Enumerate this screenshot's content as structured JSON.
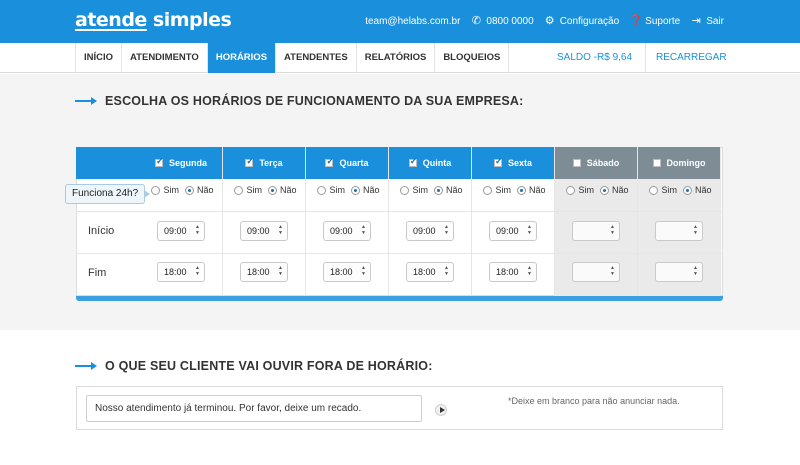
{
  "header": {
    "logo_a": "atende",
    "logo_b": " simples",
    "email": "team@helabs.com.br",
    "phone": "0800 0000",
    "config": "Configuração",
    "support": "Suporte",
    "logout": "Sair"
  },
  "nav": {
    "tabs": [
      "INÍCIO",
      "ATENDIMENTO",
      "HORÁRIOS",
      "ATENDENTES",
      "RELATÓRIOS",
      "BLOQUEIOS"
    ],
    "active_tab": "HORÁRIOS",
    "saldo": "SALDO -R$ 9,64",
    "recarregar": "RECARREGAR"
  },
  "hours_section": {
    "title": "ESCOLHA OS HORÁRIOS DE FUNCIONAMENTO DA SUA EMPRESA:",
    "tooltip": "Funciona 24h?",
    "yes_label": "Sim",
    "no_label": "Não",
    "row_start": "Início",
    "row_end": "Fim",
    "days": [
      {
        "name": "Segunda",
        "checked": true,
        "start": "09:00",
        "end": "18:00"
      },
      {
        "name": "Terça",
        "checked": true,
        "start": "09:00",
        "end": "18:00"
      },
      {
        "name": "Quarta",
        "checked": true,
        "start": "09:00",
        "end": "18:00"
      },
      {
        "name": "Quinta",
        "checked": true,
        "start": "09:00",
        "end": "18:00"
      },
      {
        "name": "Sexta",
        "checked": true,
        "start": "09:00",
        "end": "18:00"
      },
      {
        "name": "Sábado",
        "checked": false,
        "start": "",
        "end": ""
      },
      {
        "name": "Domingo",
        "checked": false,
        "start": "",
        "end": ""
      }
    ]
  },
  "message_section": {
    "title": "O QUE SEU CLIENTE VAI OUVIR FORA DE HORÁRIO:",
    "message": "Nosso atendimento já terminou. Por favor, deixe um recado.",
    "hint": "*Deixe em branco para não anunciar nada."
  },
  "colors": {
    "primary": "#1a90dc",
    "weekend_header": "#7d8c95"
  }
}
